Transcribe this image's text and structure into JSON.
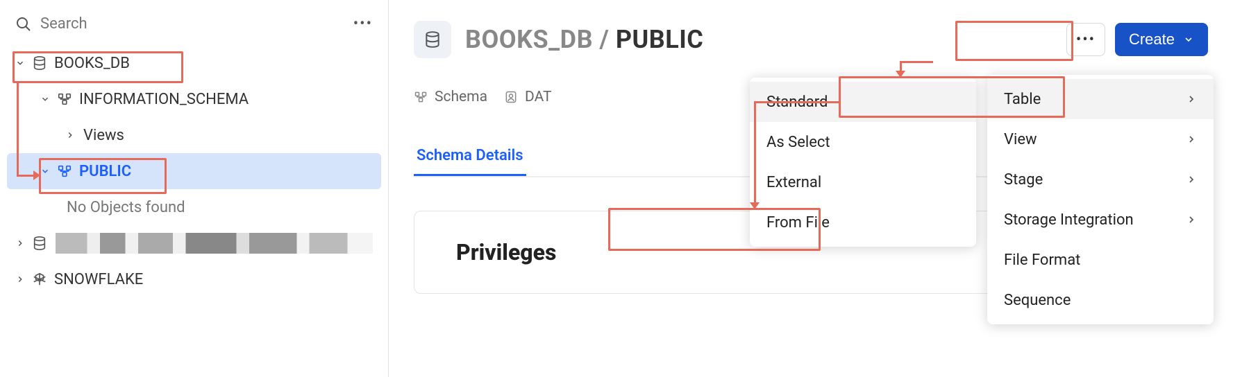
{
  "sidebar": {
    "search_placeholder": "Search",
    "tree": {
      "books_db": "BOOKS_DB",
      "info_schema": "INFORMATION_SCHEMA",
      "views": "Views",
      "public": "PUBLIC",
      "empty": "No Objects found",
      "snowflake": "SNOWFLAKE"
    }
  },
  "header": {
    "crumb_db": "BOOKS_DB",
    "crumb_sep": " / ",
    "crumb_schema": "PUBLIC",
    "create_label": "Create"
  },
  "chips": {
    "schema": "Schema",
    "dat_prefix": "DAT"
  },
  "tabs": {
    "details": "Schema Details"
  },
  "card": {
    "privileges": "Privileges"
  },
  "create_menu": {
    "table": "Table",
    "view": "View",
    "stage": "Stage",
    "storage_integration": "Storage Integration",
    "file_format": "File Format",
    "sequence": "Sequence"
  },
  "sub_menu": {
    "standard": "Standard",
    "as_select": "As Select",
    "external": "External",
    "from_file": "From File"
  }
}
